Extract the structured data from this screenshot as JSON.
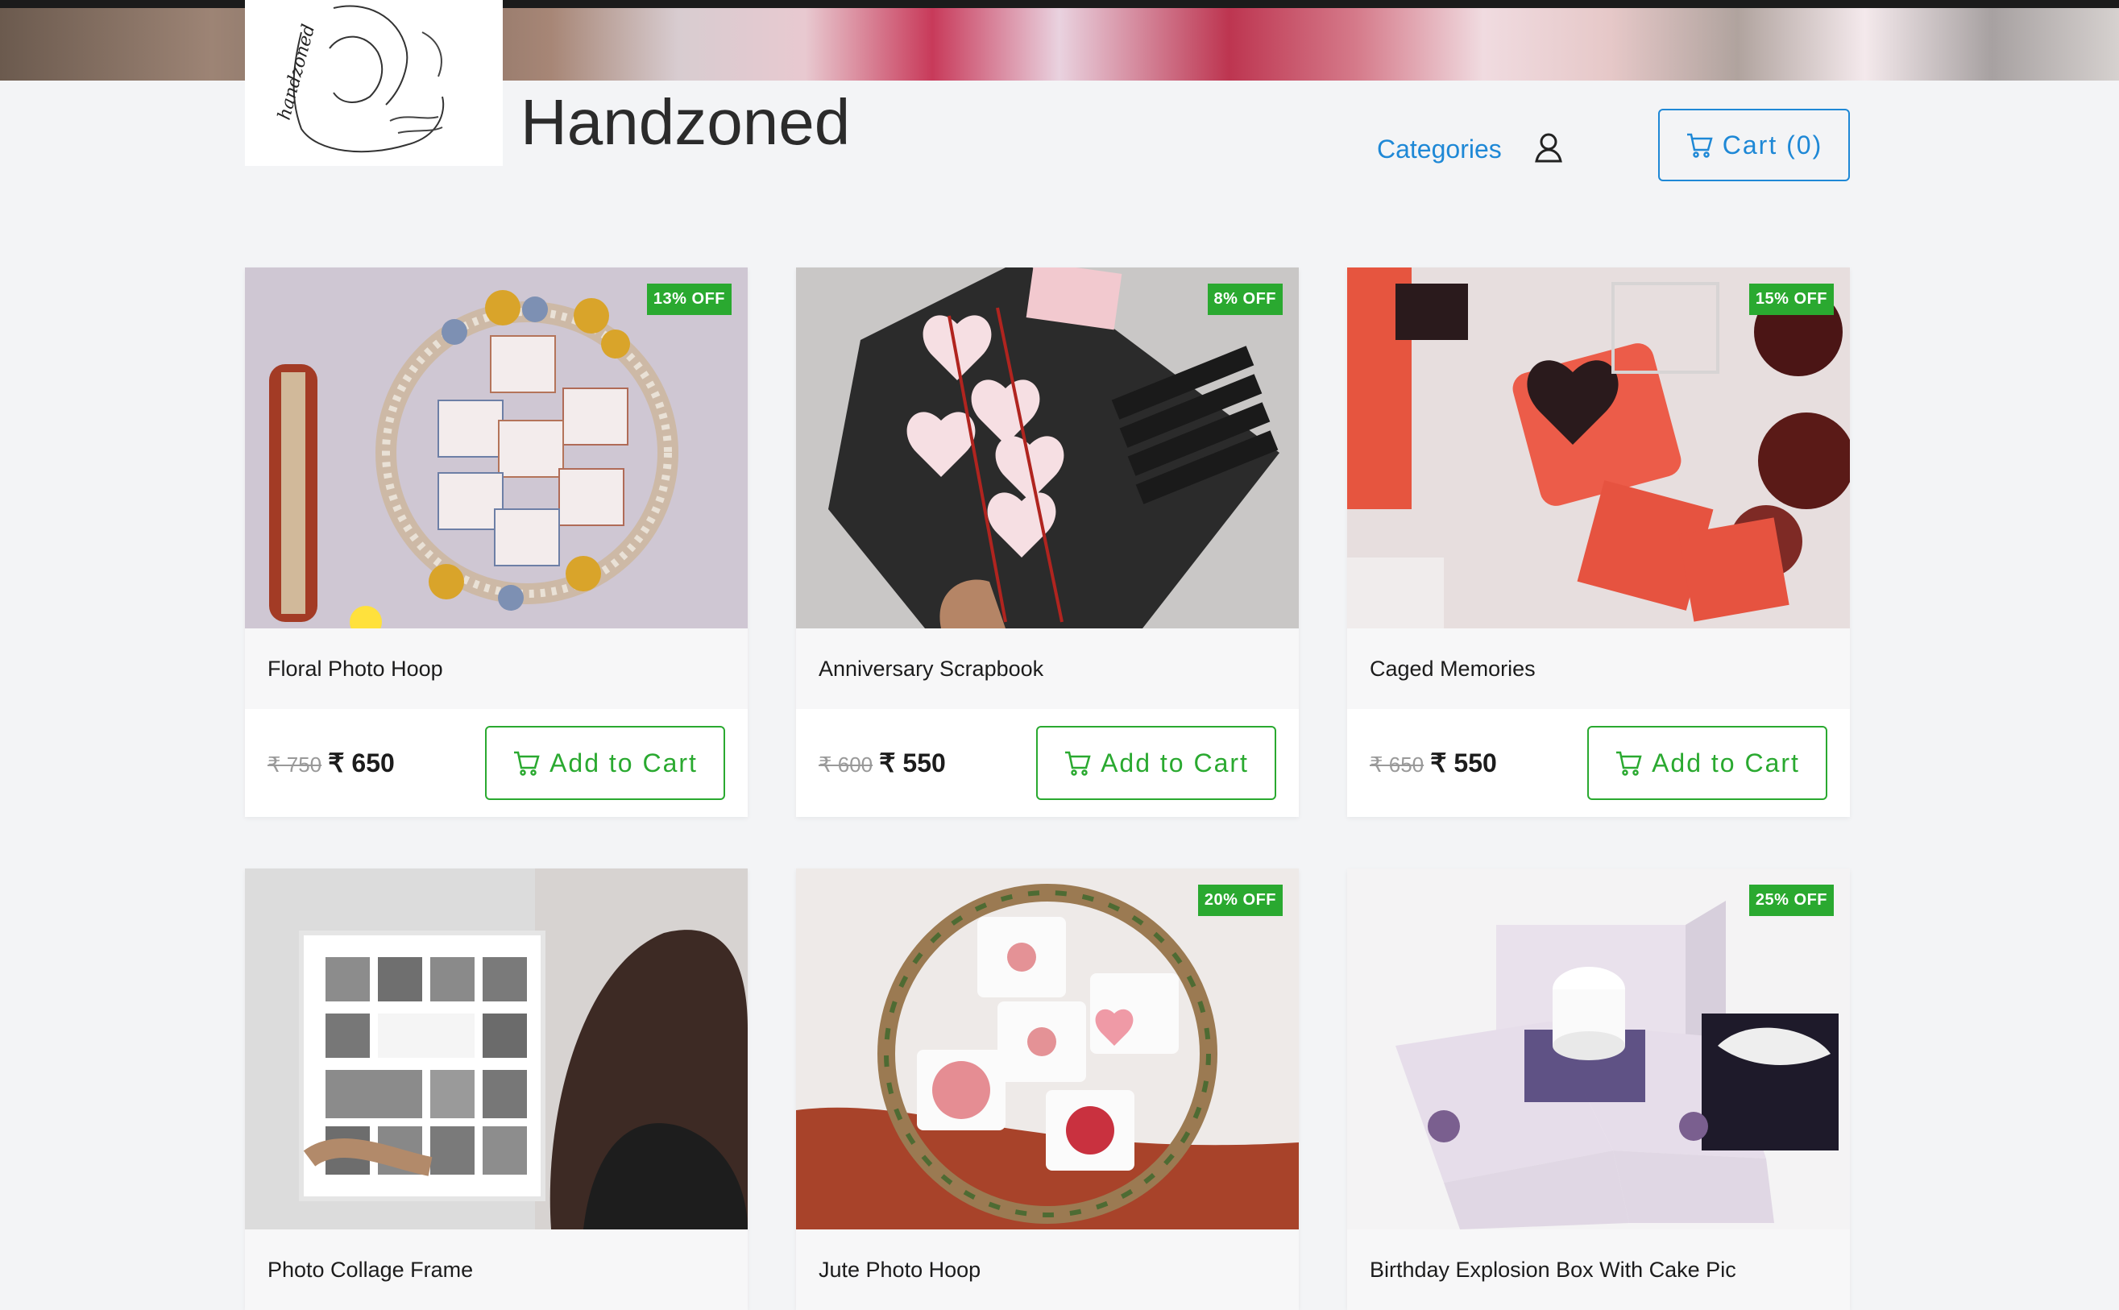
{
  "header": {
    "site_title": "Handzoned",
    "categories_label": "Categories",
    "cart_label": "Cart (0)"
  },
  "colors": {
    "accent_blue": "#1e88d6",
    "accent_green": "#2aa930",
    "background": "#f3f4f6"
  },
  "products": [
    {
      "name": "Floral Photo Hoop",
      "badge": "13% OFF",
      "old_price": "₹ 750",
      "new_price": "₹ 650",
      "button": "Add to Cart"
    },
    {
      "name": "Anniversary Scrapbook",
      "badge": "8% OFF",
      "old_price": "₹ 600",
      "new_price": "₹ 550",
      "button": "Add to Cart"
    },
    {
      "name": "Caged Memories",
      "badge": "15% OFF",
      "old_price": "₹ 650",
      "new_price": "₹ 550",
      "button": "Add to Cart"
    },
    {
      "name": "Photo Collage Frame",
      "badge": ""
    },
    {
      "name": "Jute Photo Hoop",
      "badge": "20% OFF"
    },
    {
      "name": "Birthday Explosion Box With Cake Pic",
      "badge": "25% OFF"
    }
  ]
}
